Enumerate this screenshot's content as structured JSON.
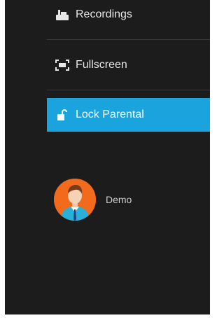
{
  "menu": {
    "items": [
      {
        "label": "Recordings",
        "icon": "recordings-icon"
      },
      {
        "label": "Fullscreen",
        "icon": "fullscreen-icon"
      },
      {
        "label": "Lock Parental",
        "icon": "lock-open-icon",
        "active": true
      }
    ]
  },
  "profile": {
    "name": "Demo",
    "avatar": "user-avatar"
  },
  "colors": {
    "panel_bg": "#1c1c1c",
    "accent": "#1aa3dd",
    "text": "#e6e6e6",
    "avatar_bg": "#f26a1b"
  }
}
